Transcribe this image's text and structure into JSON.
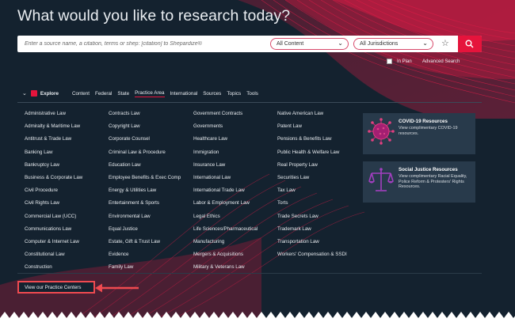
{
  "headline": "What would you like to research today?",
  "search": {
    "placeholder": "Enter a source name, a citation, terms or shep: [citation] to Shepardize®",
    "content_select": "All Content",
    "jurisdiction_select": "All Jurisdictions"
  },
  "options": {
    "in_plan_label": "In Plan",
    "advanced_search_label": "Advanced Search"
  },
  "nav": {
    "explore_label": "Explore",
    "tabs": [
      "Content",
      "Federal",
      "State",
      "Practice Area",
      "International",
      "Sources",
      "Topics",
      "Tools"
    ],
    "active_tab": "Practice Area"
  },
  "practice_areas": {
    "col1": [
      "Administrative Law",
      "Admiralty & Maritime Law",
      "Antitrust & Trade Law",
      "Banking Law",
      "Bankruptcy Law",
      "Business & Corporate Law",
      "Civil Procedure",
      "Civil Rights Law",
      "Commercial Law (UCC)",
      "Communications Law",
      "Computer & Internet Law",
      "Constitutional Law",
      "Construction"
    ],
    "col2": [
      "Contracts Law",
      "Copyright Law",
      "Corporate Counsel",
      "Criminal Law & Procedure",
      "Education Law",
      "Employee Benefits & Exec Comp",
      "Energy & Utilities Law",
      "Entertainment & Sports",
      "Environmental Law",
      "Equal Justice",
      "Estate, Gift & Trust Law",
      "Evidence",
      "Family Law"
    ],
    "col3": [
      "Government Contracts",
      "Governments",
      "Healthcare Law",
      "Immigration",
      "Insurance Law",
      "International Law",
      "International Trade Law",
      "Labor & Employment Law",
      "Legal Ethics",
      "Life Sciences/Pharmaceutical",
      "Manufacturing",
      "Mergers & Acquisitions",
      "Military & Veterans Law"
    ],
    "col4": [
      "Native American Law",
      "Patent Law",
      "Pensions & Benefits Law",
      "Public Health & Welfare Law",
      "Real Property Law",
      "Securities Law",
      "Tax Law",
      "Torts",
      "Trade Secrets Law",
      "Trademark Law",
      "Transportation Law",
      "Workers' Compensation & SSDI"
    ]
  },
  "cards": [
    {
      "title": "COVID-19 Resources",
      "description": "View complimentary COVID-19 resources.",
      "icon": "virus-icon"
    },
    {
      "title": "Social Justice Resources",
      "description": "View complimentary Racial Equality, Police Reform & Protesters' Rights Resources.",
      "icon": "scales-icon"
    }
  ],
  "practice_centers_link": "View our Practice Centers",
  "colors": {
    "background": "#14222f",
    "accent": "#e5143c",
    "card_bg": "#283a4b",
    "callout": "#ef4a50"
  }
}
